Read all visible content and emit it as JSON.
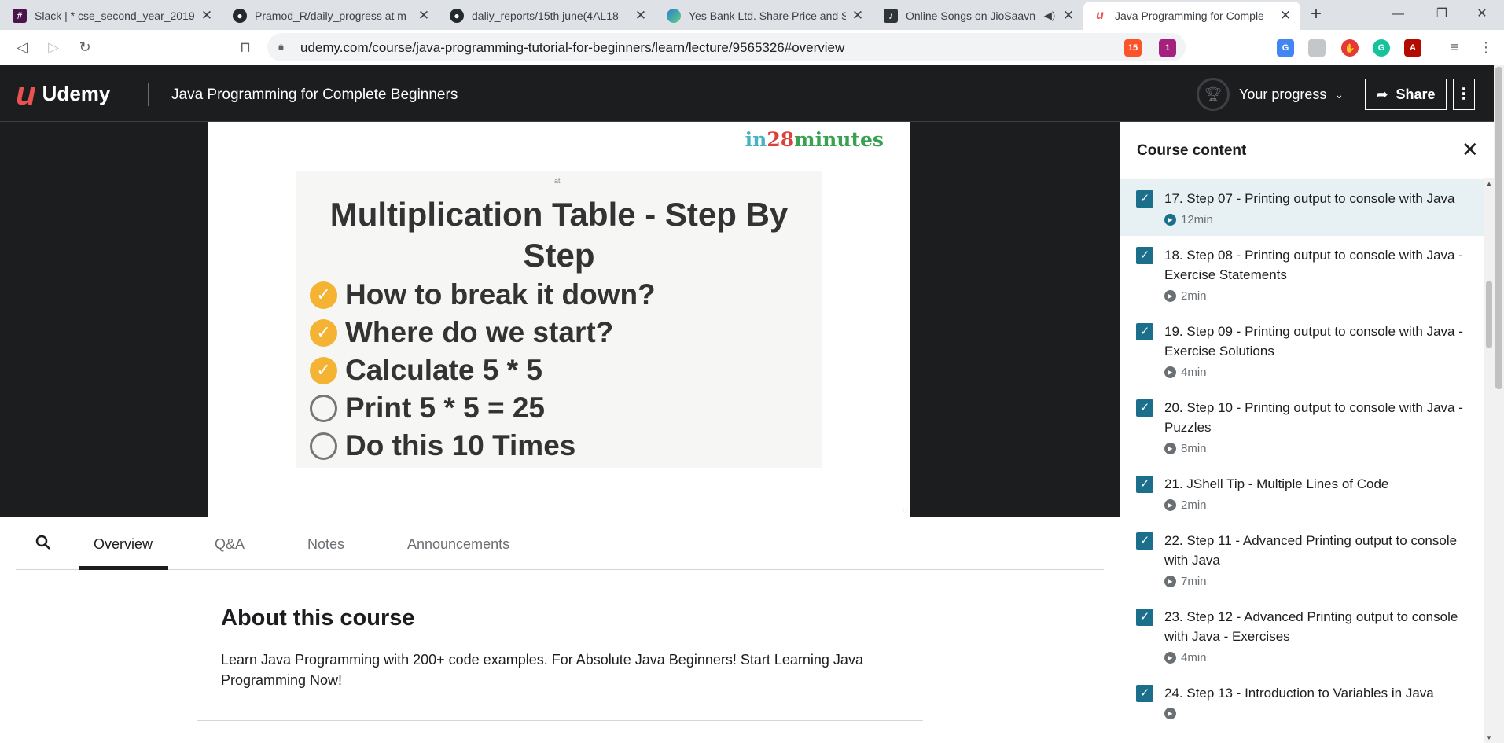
{
  "browser": {
    "tabs": [
      {
        "title": "Slack | * cse_second_year_2019",
        "favicon": "slack-icon",
        "color": "#4a154b"
      },
      {
        "title": "Pramod_R/daily_progress at m",
        "favicon": "github-icon",
        "color": "#24292e"
      },
      {
        "title": "daliy_reports/15th june(4AL18",
        "favicon": "github-icon",
        "color": "#24292e"
      },
      {
        "title": "Yes Bank Ltd. Share Price and S",
        "favicon": "moneycontrol-icon",
        "color": "#2b7bd9"
      },
      {
        "title": "Online Songs on JioSaavn",
        "favicon": "jiosaavn-icon",
        "color": "#2bc5b4"
      },
      {
        "title": "Java Programming for Comple",
        "favicon": "udemy-icon",
        "color": "#ea5252"
      }
    ],
    "url": "udemy.com/course/java-programming-tutorial-for-beginners/learn/lecture/9565326#overview",
    "extensions": {
      "brave_count": "15",
      "alert_count": "1"
    }
  },
  "header": {
    "logo_text": "Udemy",
    "course_title": "Java Programming for Complete Beginners",
    "progress_label": "Your progress",
    "share_label": "Share"
  },
  "slide": {
    "brand_in": "in",
    "brand_num": "28",
    "brand_min": "minutes",
    "tiny_label": "at",
    "title": "Multiplication Table - Step By Step",
    "bullets": [
      {
        "text": "How to break it down?",
        "done": true
      },
      {
        "text": "Where do we start?",
        "done": true
      },
      {
        "text": "Calculate 5 * 5",
        "done": true
      },
      {
        "text": "Print 5 * 5 = 25",
        "done": false
      },
      {
        "text": "Do this 10 Times",
        "done": false
      }
    ]
  },
  "content_tabs": {
    "overview": "Overview",
    "qa": "Q&A",
    "notes": "Notes",
    "announcements": "Announcements"
  },
  "about": {
    "title": "About this course",
    "text": "Learn Java Programming with 200+ code examples. For Absolute Java Beginners! Start Learning Java Programming Now!"
  },
  "sidebar": {
    "title": "Course content",
    "items": [
      {
        "title": "17. Step 07 - Printing output to console with Java",
        "duration": "12min",
        "current": true
      },
      {
        "title": "18. Step 08 - Printing output to console with Java - Exercise Statements",
        "duration": "2min",
        "current": false
      },
      {
        "title": "19. Step 09 - Printing output to console with Java - Exercise Solutions",
        "duration": "4min",
        "current": false
      },
      {
        "title": "20. Step 10 - Printing output to console with Java - Puzzles",
        "duration": "8min",
        "current": false
      },
      {
        "title": "21. JShell Tip - Multiple Lines of Code",
        "duration": "2min",
        "current": false
      },
      {
        "title": "22. Step 11 - Advanced Printing output to console with Java",
        "duration": "7min",
        "current": false
      },
      {
        "title": "23. Step 12 - Advanced Printing output to console with Java - Exercises",
        "duration": "4min",
        "current": false
      },
      {
        "title": "24. Step 13 - Introduction to Variables in Java",
        "duration": "",
        "current": false
      }
    ]
  }
}
